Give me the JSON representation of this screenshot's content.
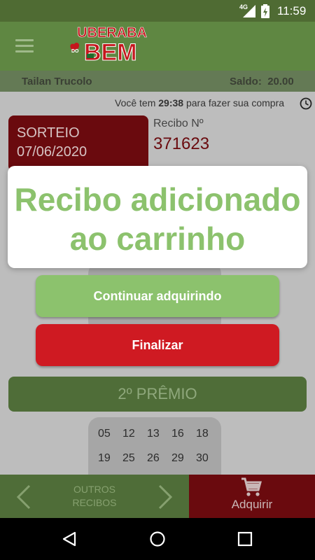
{
  "status_bar": {
    "network": "4G",
    "time": "11:59"
  },
  "app": {
    "logo_top": "UBERABA",
    "logo_small": "DO",
    "logo_bottom": "BEM"
  },
  "user": {
    "name": "Tailan Trucolo",
    "saldo_label": "Saldo:",
    "saldo_value": "20.00"
  },
  "timer": {
    "prefix": "Você tem",
    "time": "29:38",
    "suffix": "para fazer sua compra"
  },
  "ticket": {
    "sorteio_label": "SORTEIO",
    "date": "07/06/2020",
    "recibo_label": "Recibo Nº",
    "recibo_number": "371623"
  },
  "premio": {
    "label": "2º PRÊMIO"
  },
  "numbers": {
    "row1": [
      "05",
      "12",
      "13",
      "16",
      "18"
    ],
    "row2": [
      "19",
      "25",
      "26",
      "29",
      "30"
    ]
  },
  "bottom_nav": {
    "outros_line1": "OUTROS",
    "outros_line2": "RECIBOS",
    "adquirir": "Adquirir"
  },
  "dialog": {
    "line1": "Recibo adicionado",
    "line2": "ao carrinho",
    "continue_button": "Continuar adquirindo",
    "finish_button": "Finalizar"
  },
  "colors": {
    "green": "#8cc26d",
    "red": "#cf1a22",
    "dark_green": "#4f6d38",
    "dark_red": "#6a0a0e"
  }
}
